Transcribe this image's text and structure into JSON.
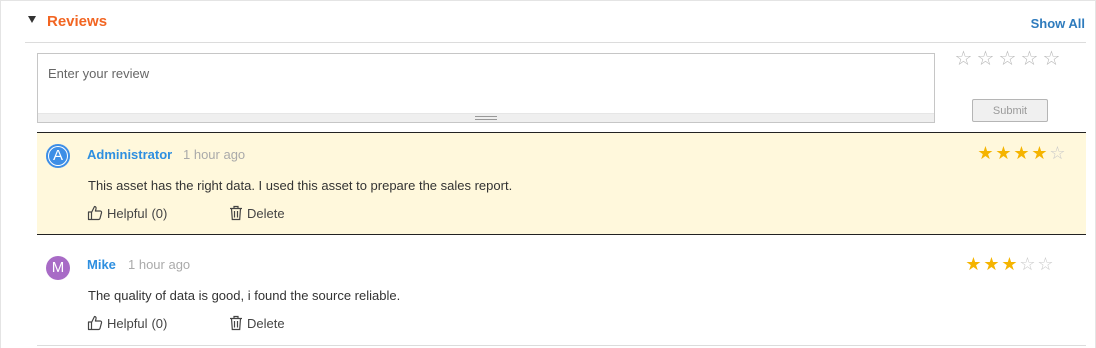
{
  "section": {
    "title": "Reviews",
    "show_all_label": "Show All"
  },
  "composer": {
    "placeholder": "Enter your review",
    "value": "",
    "rating": 0,
    "max_rating": 5,
    "submit_label": "Submit"
  },
  "reviews": [
    {
      "avatar_letter": "A",
      "author": "Administrator",
      "time": "1 hour ago",
      "rating": 4,
      "text": "This asset has the right data. I used this asset to prepare the sales report.",
      "helpful_label": "Helpful",
      "helpful_count": "(0)",
      "delete_label": "Delete",
      "avatar_color": "#3d8ee6",
      "highlighted": true
    },
    {
      "avatar_letter": "M",
      "author": "Mike",
      "time": "1 hour ago",
      "rating": 3,
      "text": "The quality of data is good, i found the source reliable.",
      "helpful_label": "Helpful",
      "helpful_count": "(0)",
      "delete_label": "Delete",
      "avatar_color": "#a86bc6",
      "highlighted": false
    }
  ],
  "colors": {
    "title": "#f26522",
    "link": "#2e7bbd",
    "author": "#2e8fe0",
    "star_on": "#f5b400",
    "star_off": "#c9c9c9",
    "highlight_bg": "#fff8dc"
  },
  "icons": {
    "caret": "caret-down-icon",
    "rating_star": "star-outline-icon",
    "helpful": "thumbs-up-icon",
    "delete": "trash-icon"
  }
}
